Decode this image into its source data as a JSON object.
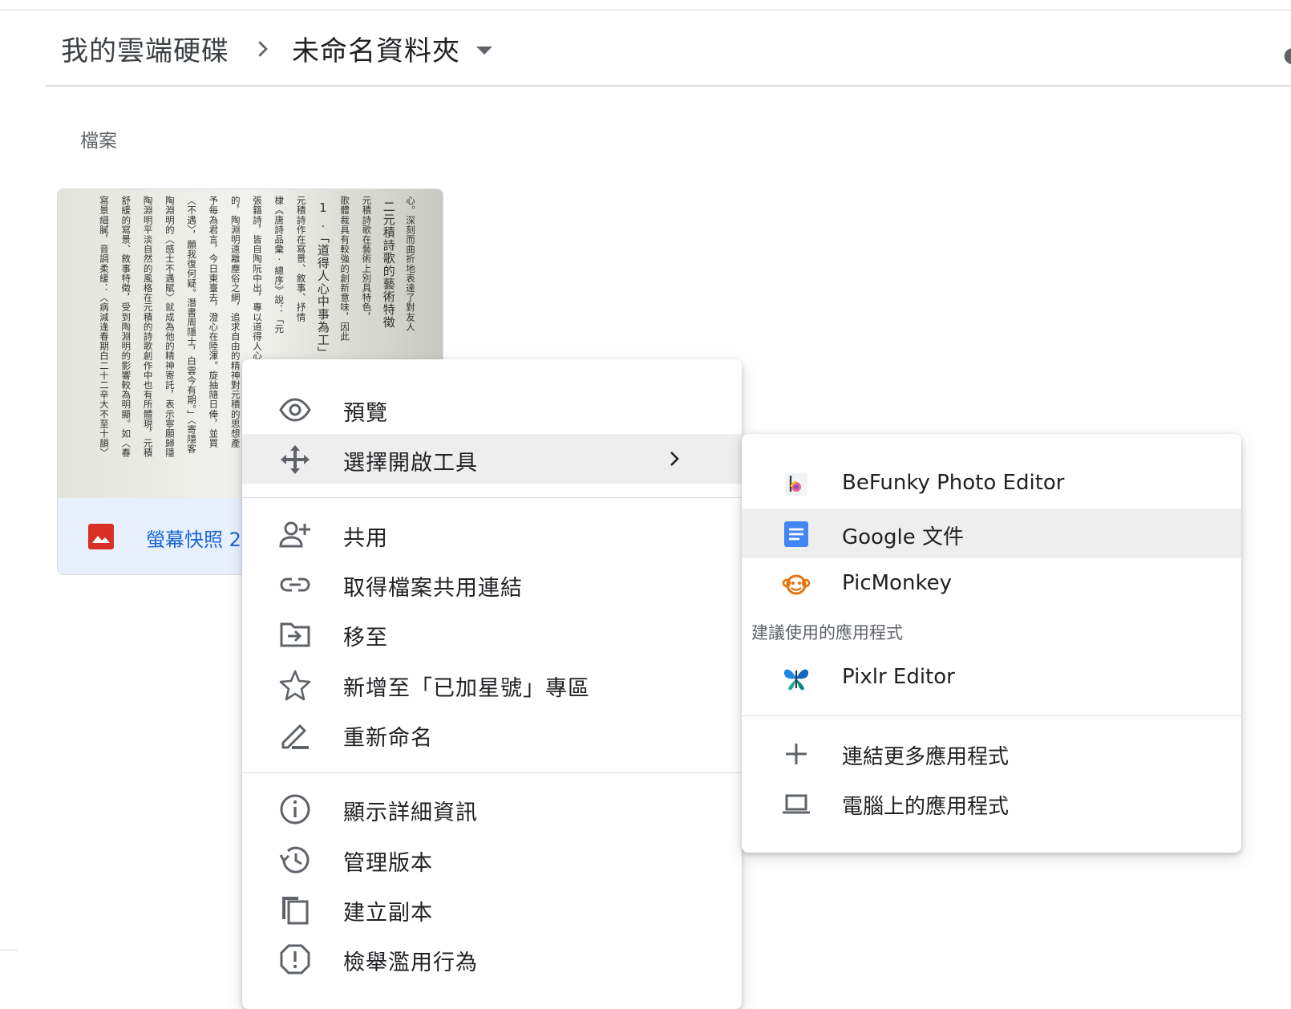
{
  "breadcrumb": {
    "root": "我的雲端硬碟",
    "current": "未命名資料夾"
  },
  "files_section": {
    "label": "檔案"
  },
  "file_card": {
    "name": "螢幕快照 2",
    "thumbnail_lines": [
      "心。深刻而曲折地表達了對友人",
      "二元積詩歌的藝術特徵",
      "元積詩歌在藝術上別具特色，",
      "歌體裁具有較強的創新意味，因此",
      "1.「道得人心中事為工」",
      "元積詩作在寫景、敘事、抒情",
      "棣《唐詩品彙·總序》說：「元",
      "張籍詩，皆自陶阮中出，專以道得人心中事為工。」張戒指",
      "的，陶淵明遠離塵俗之網，追求自由的精神對元積的思想產",
      "予每為君言，今日東臺去，澄心在陸渾。旋抽隨日俸，並買",
      "〈不遇〉，願我復何疑。潛書周隱士，白雲今有期。」〈寄隱客",
      "陶淵明的〈感士不遇賦〉就成為他的精神寄託，表示寧願歸隱",
      "陶淵明平淡自然的風格在元積的詩歌創作中也有所體現，元積",
      "舒緩的寫景、敘事特徵，受到陶淵明的影響較為明顯。如〈春",
      "寫景細膩，音調柔緩：〈病減逢春期白二十二辛大不至十韻〉"
    ]
  },
  "context_menu": {
    "items": [
      {
        "label": "預覽",
        "icon": "eye-icon"
      },
      {
        "label": "選擇開啟工具",
        "icon": "move-icon"
      },
      {
        "label": "共用",
        "icon": "person-add-icon"
      },
      {
        "label": "取得檔案共用連結",
        "icon": "link-icon"
      },
      {
        "label": "移至",
        "icon": "folder-move-icon"
      },
      {
        "label": "新增至「已加星號」專區",
        "icon": "star-icon"
      },
      {
        "label": "重新命名",
        "icon": "pencil-icon"
      },
      {
        "label": "顯示詳細資訊",
        "icon": "info-icon"
      },
      {
        "label": "管理版本",
        "icon": "history-icon"
      },
      {
        "label": "建立副本",
        "icon": "copy-icon"
      },
      {
        "label": "檢舉濫用行為",
        "icon": "report-icon"
      }
    ]
  },
  "open_with_menu": {
    "apps": [
      {
        "label": "BeFunky Photo Editor",
        "icon": "befunky-icon"
      },
      {
        "label": "Google 文件",
        "icon": "google-docs-icon"
      },
      {
        "label": "PicMonkey",
        "icon": "picmonkey-icon"
      }
    ],
    "suggested_heading": "建議使用的應用程式",
    "suggested": [
      {
        "label": "Pixlr Editor",
        "icon": "pixlr-icon"
      }
    ],
    "actions": [
      {
        "label": "連結更多應用程式",
        "icon": "plus-icon"
      },
      {
        "label": "電腦上的應用程式",
        "icon": "laptop-icon"
      }
    ]
  },
  "colors": {
    "selected_bg": "#e8f0fe",
    "link_blue": "#1967d2",
    "image_red": "#d93025",
    "docs_blue": "#4285f4",
    "hover_gray": "#eeeeee"
  }
}
